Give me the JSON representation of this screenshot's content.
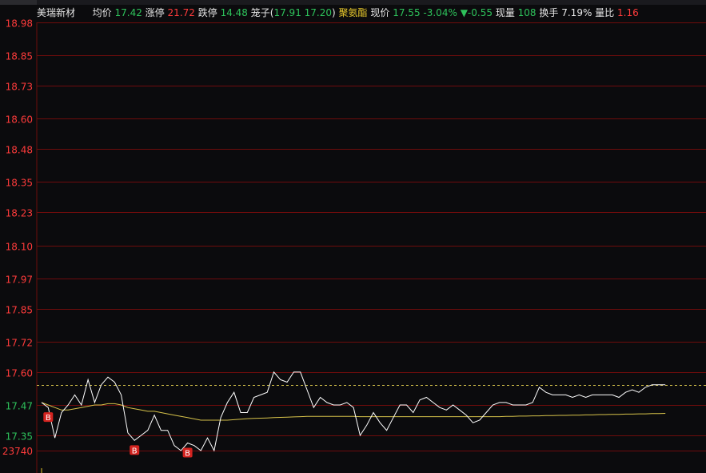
{
  "stock": {
    "name": "美瑞新材",
    "avg_label": "均价",
    "avg_value": "17.42",
    "limit_up_label": "涨停",
    "limit_up_value": "21.72",
    "limit_down_label": "跌停",
    "limit_down_value": "14.48",
    "cage_label": "笼子",
    "cage_open": "(",
    "cage_high": "17.91",
    "cage_low": "17.20",
    "cage_close": ")",
    "concept": "聚氨酯",
    "price_label": "现价",
    "price_value": "17.55",
    "change_pct": "-3.04%",
    "change_arrow": "▼",
    "change_value": "-0.55",
    "volume_label": "现量",
    "volume_value": "108",
    "turnover_label": "换手",
    "turnover_value": "7.19%",
    "vol_ratio_label": "量比",
    "vol_ratio_value": "1.16"
  },
  "colors": {
    "up": "#ff3b3b",
    "down": "#2ec25b",
    "neutral": "#e6e6e6",
    "grid": "#6e0c0c",
    "price_line": "#ffffff",
    "avg_line": "#d6c24a",
    "prev_close_line": "#d6c24a",
    "buy_marker": "#d3231f"
  },
  "chart_data": {
    "type": "line",
    "y_tick_labels": [
      "18.98",
      "18.85",
      "18.73",
      "18.60",
      "18.48",
      "18.35",
      "18.23",
      "18.10",
      "17.97",
      "17.85",
      "17.72",
      "17.60",
      "17.47",
      "17.35"
    ],
    "bottom_label": "23740",
    "prev_close": "17.55",
    "ylim": [
      17.29,
      18.98
    ],
    "series": [
      {
        "values": [
          17.48,
          17.46,
          17.34,
          17.44,
          17.47,
          17.51,
          17.47,
          17.57,
          17.48,
          17.55,
          17.58,
          17.56,
          17.51,
          17.36,
          17.33,
          17.35,
          17.37,
          17.43,
          17.37,
          17.37,
          17.31,
          17.29,
          17.32,
          17.31,
          17.29,
          17.34,
          17.29,
          17.42,
          17.48,
          17.52,
          17.44,
          17.44,
          17.5,
          17.51,
          17.52,
          17.6,
          17.57,
          17.56,
          17.6,
          17.6,
          17.53,
          17.46,
          17.5,
          17.48,
          17.47,
          17.47,
          17.48,
          17.46,
          17.35,
          17.39,
          17.44,
          17.4,
          17.37,
          17.42,
          17.47,
          17.47,
          17.44,
          17.49,
          17.5,
          17.48,
          17.46,
          17.45,
          17.47,
          17.45,
          17.43,
          17.4,
          17.41,
          17.44,
          17.47,
          17.48,
          17.48,
          17.47,
          17.47,
          17.47,
          17.48,
          17.54,
          17.52,
          17.51,
          17.51,
          17.51,
          17.5,
          17.51,
          17.5,
          17.51,
          17.51,
          17.51,
          17.51,
          17.5,
          17.52,
          17.53,
          17.52,
          17.54,
          17.55,
          17.55,
          17.55
        ]
      },
      {
        "values": [
          17.48,
          17.47,
          17.46,
          17.45,
          17.45,
          17.455,
          17.46,
          17.465,
          17.47,
          17.47,
          17.475,
          17.475,
          17.47,
          17.46,
          17.455,
          17.45,
          17.445,
          17.445,
          17.44,
          17.435,
          17.43,
          17.425,
          17.42,
          17.415,
          17.41,
          17.41,
          17.41,
          17.41,
          17.41,
          17.412,
          17.414,
          17.416,
          17.417,
          17.418,
          17.419,
          17.42,
          17.421,
          17.422,
          17.423,
          17.424,
          17.425,
          17.425,
          17.425,
          17.425,
          17.425,
          17.425,
          17.425,
          17.425,
          17.424,
          17.424,
          17.424,
          17.424,
          17.424,
          17.424,
          17.424,
          17.424,
          17.424,
          17.424,
          17.424,
          17.424,
          17.424,
          17.424,
          17.424,
          17.424,
          17.424,
          17.424,
          17.424,
          17.424,
          17.424,
          17.424,
          17.425,
          17.425,
          17.426,
          17.426,
          17.427,
          17.427,
          17.428,
          17.428,
          17.429,
          17.429,
          17.43,
          17.43,
          17.431,
          17.431,
          17.432,
          17.432,
          17.433,
          17.433,
          17.434,
          17.434,
          17.435,
          17.435,
          17.436,
          17.436,
          17.437
        ]
      }
    ],
    "buy_markers": [
      {
        "index": 1,
        "label": "B"
      },
      {
        "index": 14,
        "label": "B"
      },
      {
        "index": 22,
        "label": "B"
      }
    ]
  }
}
